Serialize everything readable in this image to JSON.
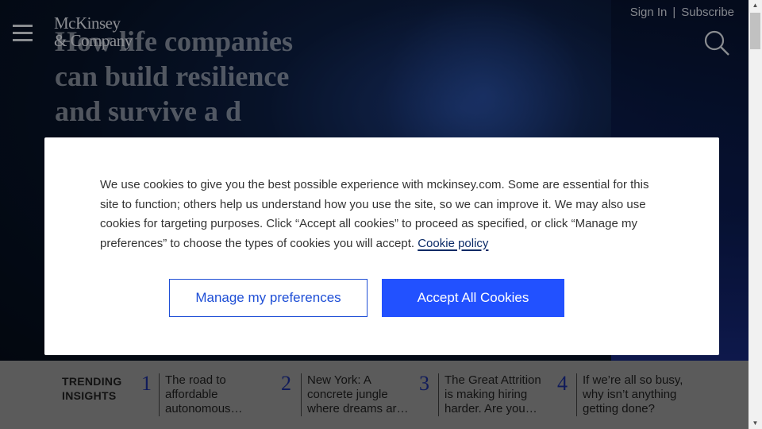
{
  "header": {
    "logo_line1": "McKinsey",
    "logo_line2": "& Company",
    "sign_in": "Sign In",
    "separator": "|",
    "subscribe": "Subscribe",
    "menu_icon": "hamburger-menu-icon",
    "search_icon": "search-icon"
  },
  "hero": {
    "headline": "How life companies can build resilience and survive a d"
  },
  "cookie_modal": {
    "text": "We use cookies to give you the best possible experience with mckinsey.com. Some are essential for this site to function; others help us understand how you use the site, so we can improve it. We may also use cookies for targeting purposes. Click “Accept all cookies” to proceed as specified, or click “Manage my preferences” to choose the types of cookies you will accept.",
    "policy_link": "Cookie policy",
    "manage_button": "Manage my preferences",
    "accept_button": "Accept All Cookies"
  },
  "trending": {
    "label": "TRENDING INSIGHTS",
    "items": [
      {
        "number": "1",
        "title": "The road to affordable autonomous…"
      },
      {
        "number": "2",
        "title": "New York: A concrete jungle where dreams ar…"
      },
      {
        "number": "3",
        "title": "The Great Attrition is making hiring harder. Are you…"
      },
      {
        "number": "4",
        "title": "If we’re all so busy, why isn’t anything getting done?"
      }
    ]
  },
  "colors": {
    "accent_blue": "#2251ff",
    "trending_number": "#1a2a8a",
    "hero_background": "#071226"
  }
}
